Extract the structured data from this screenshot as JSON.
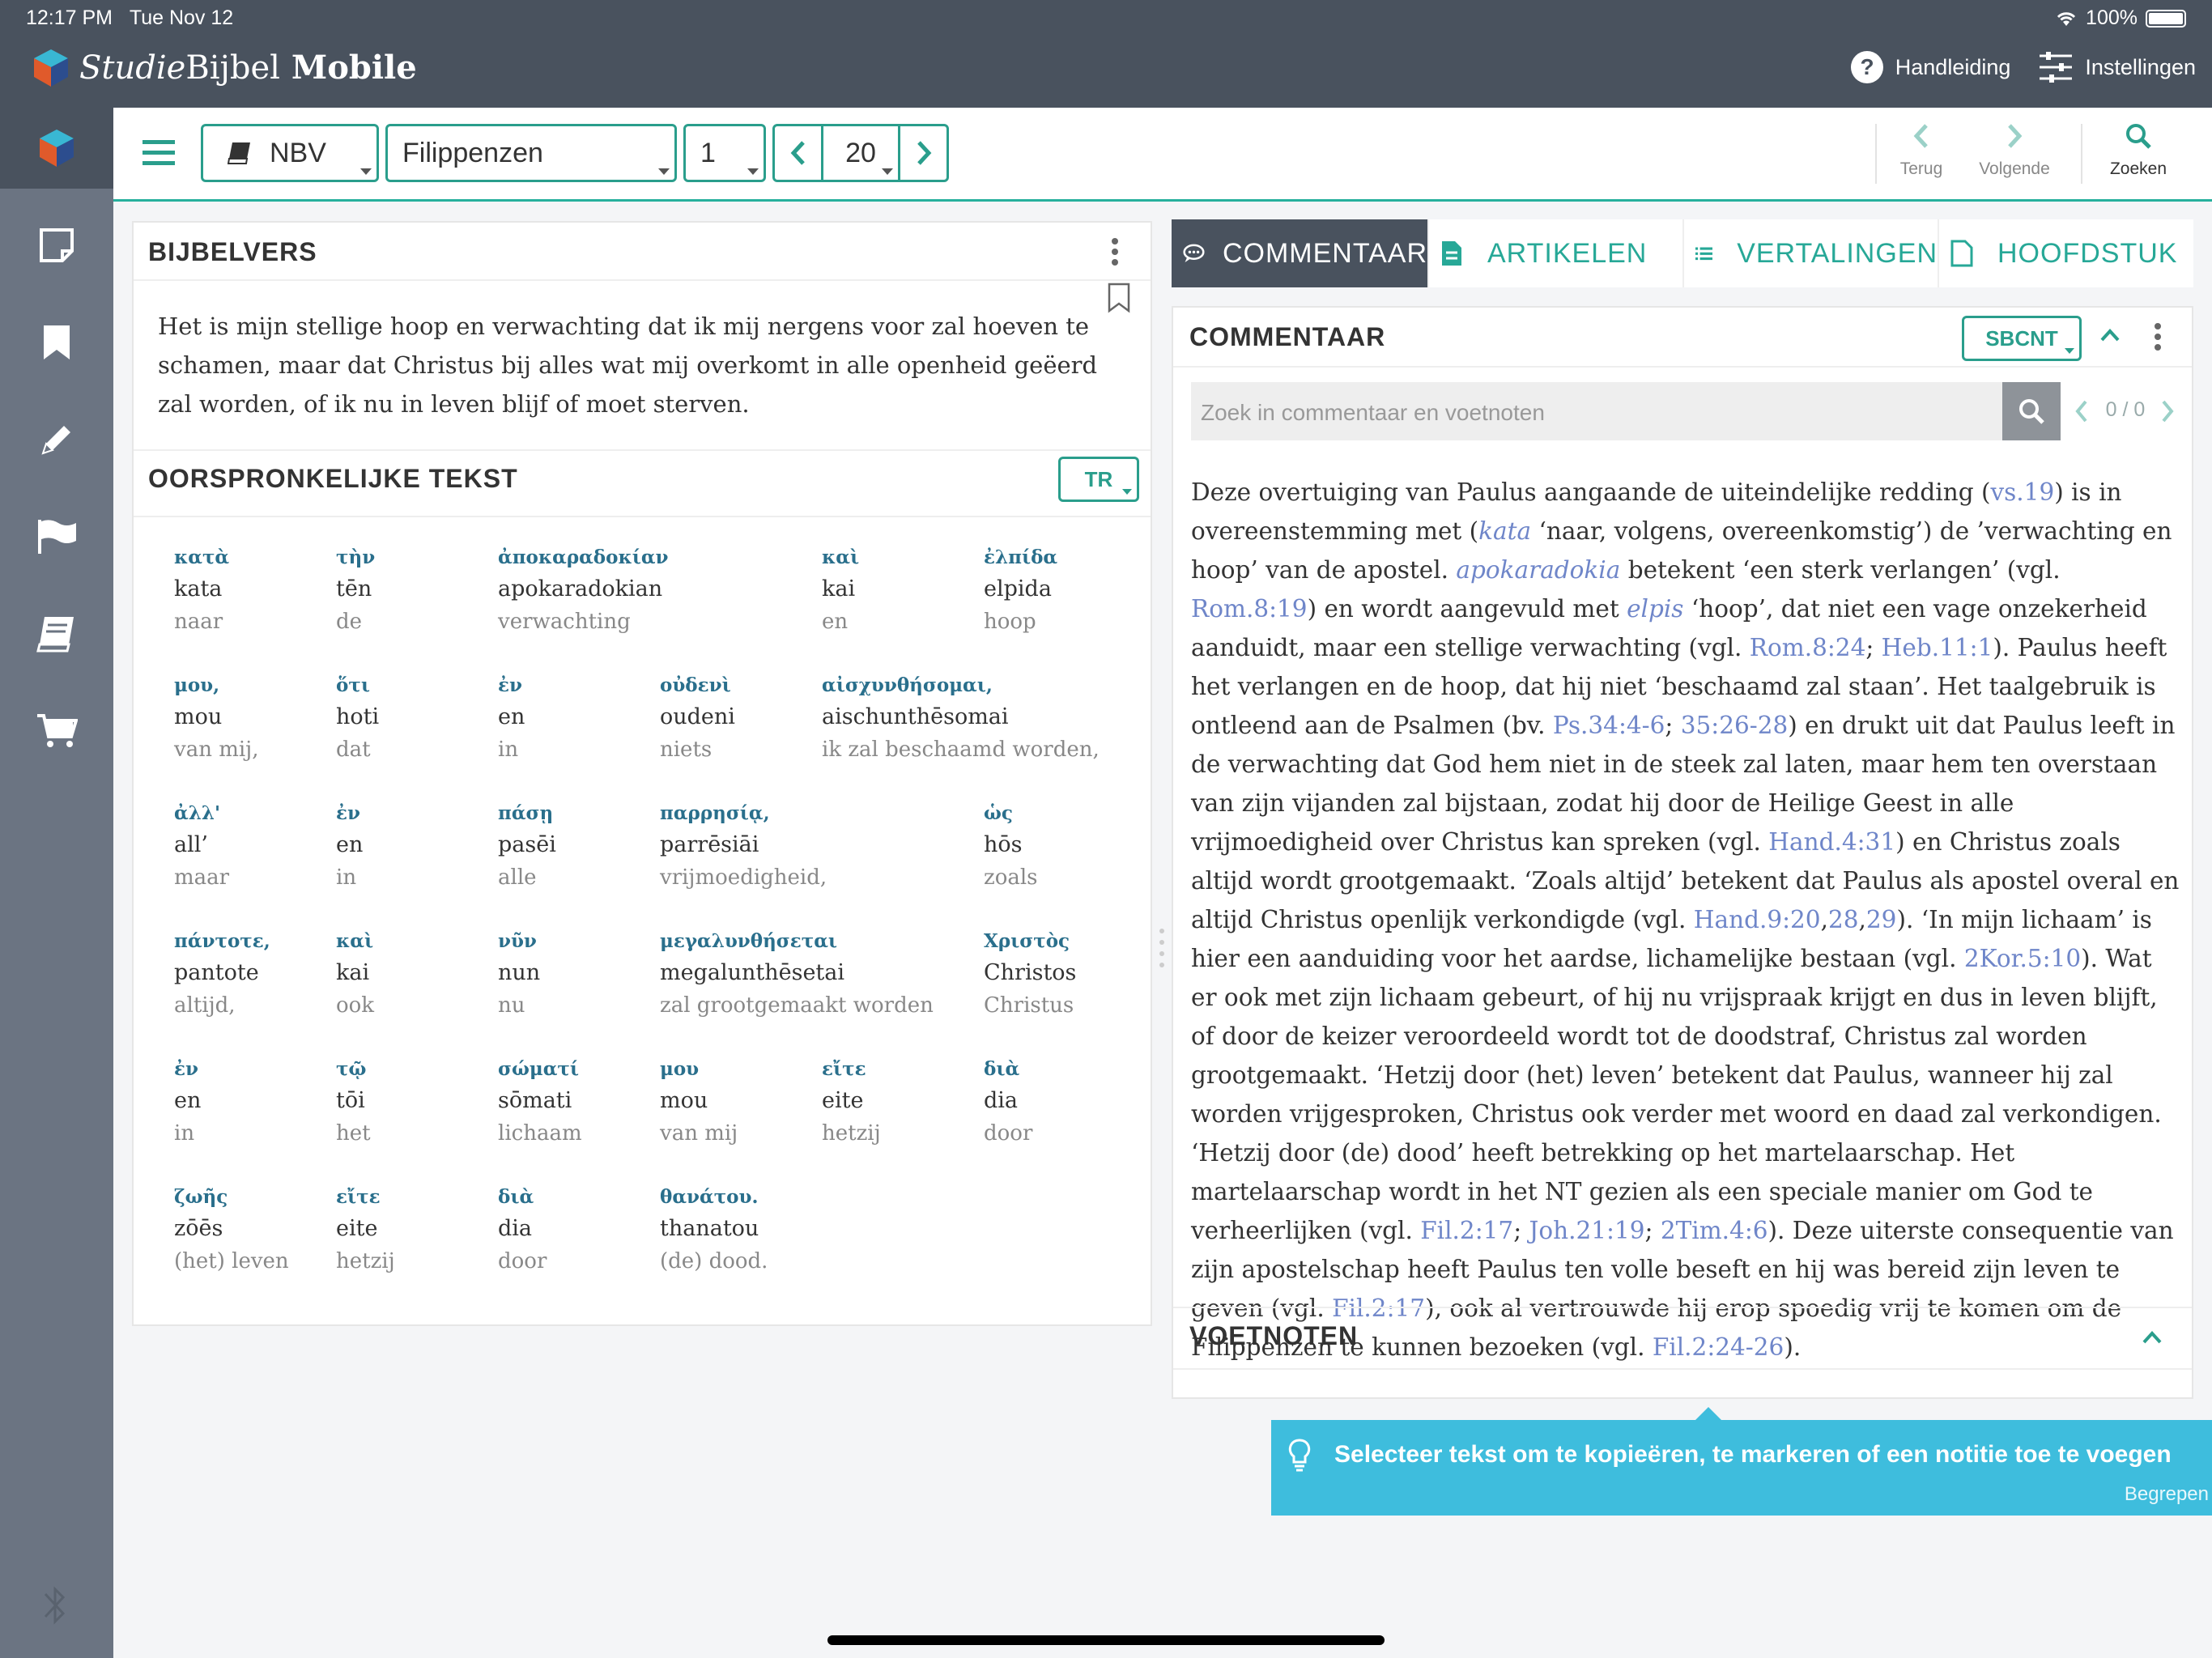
{
  "status": {
    "time": "12:17 PM",
    "date": "Tue Nov 12",
    "battery": "100%"
  },
  "app": {
    "name_part1": "Studie",
    "name_part2": "Bijbel",
    "name_part3": " Mobile"
  },
  "header": {
    "help_label": "Handleiding",
    "settings_label": "Instellingen"
  },
  "toolbar": {
    "translation": "NBV",
    "book": "Filippenzen",
    "chapter": "1",
    "verse": "20",
    "back_label": "Terug",
    "next_label": "Volgende",
    "search_label": "Zoeken"
  },
  "bijbelvers": {
    "title": "BIJBELVERS",
    "text": "Het is mijn stellige hoop en verwachting dat ik mij nergens voor zal hoeven te schamen, maar dat Christus bij alles wat mij overkomt in alle openheid geëerd zal worden, of ik nu in leven blijf of moet sterven."
  },
  "original": {
    "title": "OORSPRONKELIJKE TEKST",
    "source": "TR",
    "words": [
      {
        "gk": "κατὰ",
        "tr": "kata",
        "mn": "naar"
      },
      {
        "gk": "τὴν",
        "tr": "tēn",
        "mn": "de"
      },
      {
        "gk": "ἀποκαραδοκίαν",
        "tr": "apokaradokian",
        "mn": "verwachting"
      },
      {
        "gk": "καὶ",
        "tr": "kai",
        "mn": "en"
      },
      {
        "gk": "ἐλπίδα",
        "tr": "elpida",
        "mn": "hoop"
      },
      {
        "gk": "μου,",
        "tr": "mou",
        "mn": "van mij,"
      },
      {
        "gk": "ὅτι",
        "tr": "hoti",
        "mn": "dat"
      },
      {
        "gk": "ἐν",
        "tr": "en",
        "mn": "in"
      },
      {
        "gk": "οὐδενὶ",
        "tr": "oudeni",
        "mn": "niets"
      },
      {
        "gk": "αἰσχυνθήσομαι,",
        "tr": "aischunthēsomai",
        "mn": "ik zal beschaamd worden,"
      },
      {
        "gk": "ἀλλ'",
        "tr": "all’",
        "mn": "maar"
      },
      {
        "gk": "ἐν",
        "tr": "en",
        "mn": "in"
      },
      {
        "gk": "πάσῃ",
        "tr": "pasēi",
        "mn": "alle"
      },
      {
        "gk": "παρρησίᾳ,",
        "tr": "parrēsiāi",
        "mn": "vrijmoedigheid,"
      },
      {
        "gk": "ὡς",
        "tr": "hōs",
        "mn": "zoals"
      },
      {
        "gk": "πάντοτε,",
        "tr": "pantote",
        "mn": "altijd,"
      },
      {
        "gk": "καὶ",
        "tr": "kai",
        "mn": "ook"
      },
      {
        "gk": "νῦν",
        "tr": "nun",
        "mn": "nu"
      },
      {
        "gk": "μεγαλυνθήσεται",
        "tr": "megalunthēsetai",
        "mn": "zal grootgemaakt worden"
      },
      {
        "gk": "Χριστὸς",
        "tr": "Christos",
        "mn": "Christus"
      },
      {
        "gk": "ἐν",
        "tr": "en",
        "mn": "in"
      },
      {
        "gk": "τῷ",
        "tr": "tōi",
        "mn": "het"
      },
      {
        "gk": "σώματί",
        "tr": "sōmati",
        "mn": "lichaam"
      },
      {
        "gk": "μου",
        "tr": "mou",
        "mn": "van mij"
      },
      {
        "gk": "εἴτε",
        "tr": "eite",
        "mn": "hetzij"
      },
      {
        "gk": "διὰ",
        "tr": "dia",
        "mn": "door"
      },
      {
        "gk": "ζωῆς",
        "tr": "zōēs",
        "mn": "(het) leven"
      },
      {
        "gk": "εἴτε",
        "tr": "eite",
        "mn": "hetzij"
      },
      {
        "gk": "διὰ",
        "tr": "dia",
        "mn": "door"
      },
      {
        "gk": "θανάτου.",
        "tr": "thanatou",
        "mn": "(de) dood."
      }
    ]
  },
  "tabs": [
    {
      "label": "COMMENTAAR",
      "icon": "comment-icon"
    },
    {
      "label": "ARTIKELEN",
      "icon": "document-icon"
    },
    {
      "label": "VERTALINGEN",
      "icon": "list-icon"
    },
    {
      "label": "HOOFDSTUK",
      "icon": "page-icon"
    }
  ],
  "commentaar": {
    "title": "COMMENTAAR",
    "source": "SBCNT",
    "search_placeholder": "Zoek in commentaar en voetnoten",
    "match_count": "0 / 0",
    "footnotes_title": "VOETNOTEN",
    "segments": [
      {
        "t": "Deze overtuiging van Paulus aangaande de uiteindelijke redding ("
      },
      {
        "t": "vs.19",
        "c": "ref"
      },
      {
        "t": ") is in overeenstemming met ("
      },
      {
        "t": "kata",
        "c": "it"
      },
      {
        "t": " ‘naar, volgens, overeenkomstig’) de ’verwachting en hoop’ van de apostel. "
      },
      {
        "t": "apokaradokia",
        "c": "it"
      },
      {
        "t": " betekent ‘een sterk verlangen’ (vgl. "
      },
      {
        "t": "Rom.8:19",
        "c": "ref"
      },
      {
        "t": ") en wordt aangevuld met "
      },
      {
        "t": "elpis",
        "c": "it"
      },
      {
        "t": " ‘hoop’, dat niet een vage onzekerheid aanduidt, maar een stellige verwachting (vgl. "
      },
      {
        "t": "Rom.8:24",
        "c": "ref"
      },
      {
        "t": "; "
      },
      {
        "t": "Heb.11:1",
        "c": "ref"
      },
      {
        "t": "). Paulus heeft het verlangen en de hoop, dat hij niet ‘beschaamd zal staan’. Het taalgebruik is ontleend aan de Psalmen (bv. "
      },
      {
        "t": "Ps.34:4-6",
        "c": "ref"
      },
      {
        "t": "; "
      },
      {
        "t": "35:26-28",
        "c": "ref"
      },
      {
        "t": ") en drukt uit dat Paulus leeft in de verwachting dat God hem niet in de steek zal laten, maar hem ten overstaan van zijn vijanden zal bijstaan, zodat hij door de Heilige Geest in alle vrijmoedigheid over Christus kan spreken (vgl. "
      },
      {
        "t": "Hand.4:31",
        "c": "ref"
      },
      {
        "t": ") en Christus zoals altijd wordt grootgemaakt. ‘Zoals altijd’ betekent dat Paulus als apostel overal en altijd Christus openlijk verkondigde (vgl. "
      },
      {
        "t": "Hand.9:20",
        "c": "ref"
      },
      {
        "t": ","
      },
      {
        "t": "28",
        "c": "ref"
      },
      {
        "t": ","
      },
      {
        "t": "29",
        "c": "ref"
      },
      {
        "t": "). ‘In mijn lichaam’ is hier een aanduiding voor het aardse, lichamelijke bestaan (vgl. "
      },
      {
        "t": "2Kor.5:10",
        "c": "ref"
      },
      {
        "t": "). Wat er ook met zijn lichaam gebeurt, of hij nu vrijspraak krijgt en dus in leven blijft, of door de keizer veroordeeld wordt tot de doodstraf, Christus zal worden grootgemaakt. ‘Hetzij door (het) leven’ betekent dat Paulus, wanneer hij zal worden vrijgesproken, Christus ook verder met woord en daad zal verkondigen. ‘Hetzij door (de) dood’ heeft betrekking op het martelaarschap. Het martelaarschap wordt in het NT gezien als een speciale manier om God te verheerlijken (vgl. "
      },
      {
        "t": "Fil.2:17",
        "c": "ref"
      },
      {
        "t": "; "
      },
      {
        "t": "Joh.21:19",
        "c": "ref"
      },
      {
        "t": "; "
      },
      {
        "t": "2Tim.4:6",
        "c": "ref"
      },
      {
        "t": "). Deze uiterste consequentie van zijn apostelschap heeft Paulus ten volle beseft en hij was bereid zijn leven te geven (vgl. "
      },
      {
        "t": "Fil.2:17",
        "c": "ref"
      },
      {
        "t": "), ook al vertrouwde hij erop spoedig vrij te komen om de Filippenzen te kunnen bezoeken (vgl. "
      },
      {
        "t": "Fil.2:24-26",
        "c": "ref"
      },
      {
        "t": ")."
      }
    ]
  },
  "toast": {
    "text": "Selecteer tekst om te kopieëren, te markeren of een notitie toe te voegen",
    "action": "Begrepen"
  },
  "colors": {
    "accent": "#27a897",
    "header": "#49525e",
    "sidebar": "#6b7482",
    "link": "#6f86c9",
    "toast": "#3ebddd"
  }
}
